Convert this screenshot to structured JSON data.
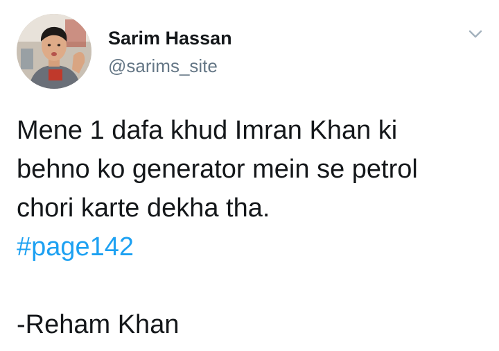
{
  "author": {
    "display_name": "Sarim Hassan",
    "handle": "@sarims_site"
  },
  "icons": {
    "avatar": "profile-photo",
    "menu": "chevron-down-icon"
  },
  "tweet": {
    "lines": [
      "Mene 1 dafa khud Imran Khan ki",
      "behno ko generator mein se petrol",
      "chori karte dekha tha."
    ],
    "hashtag": "#page142",
    "signature": "-Reham Khan"
  },
  "colors": {
    "text": "#14171a",
    "secondary": "#657786",
    "link": "#1da1f2"
  }
}
